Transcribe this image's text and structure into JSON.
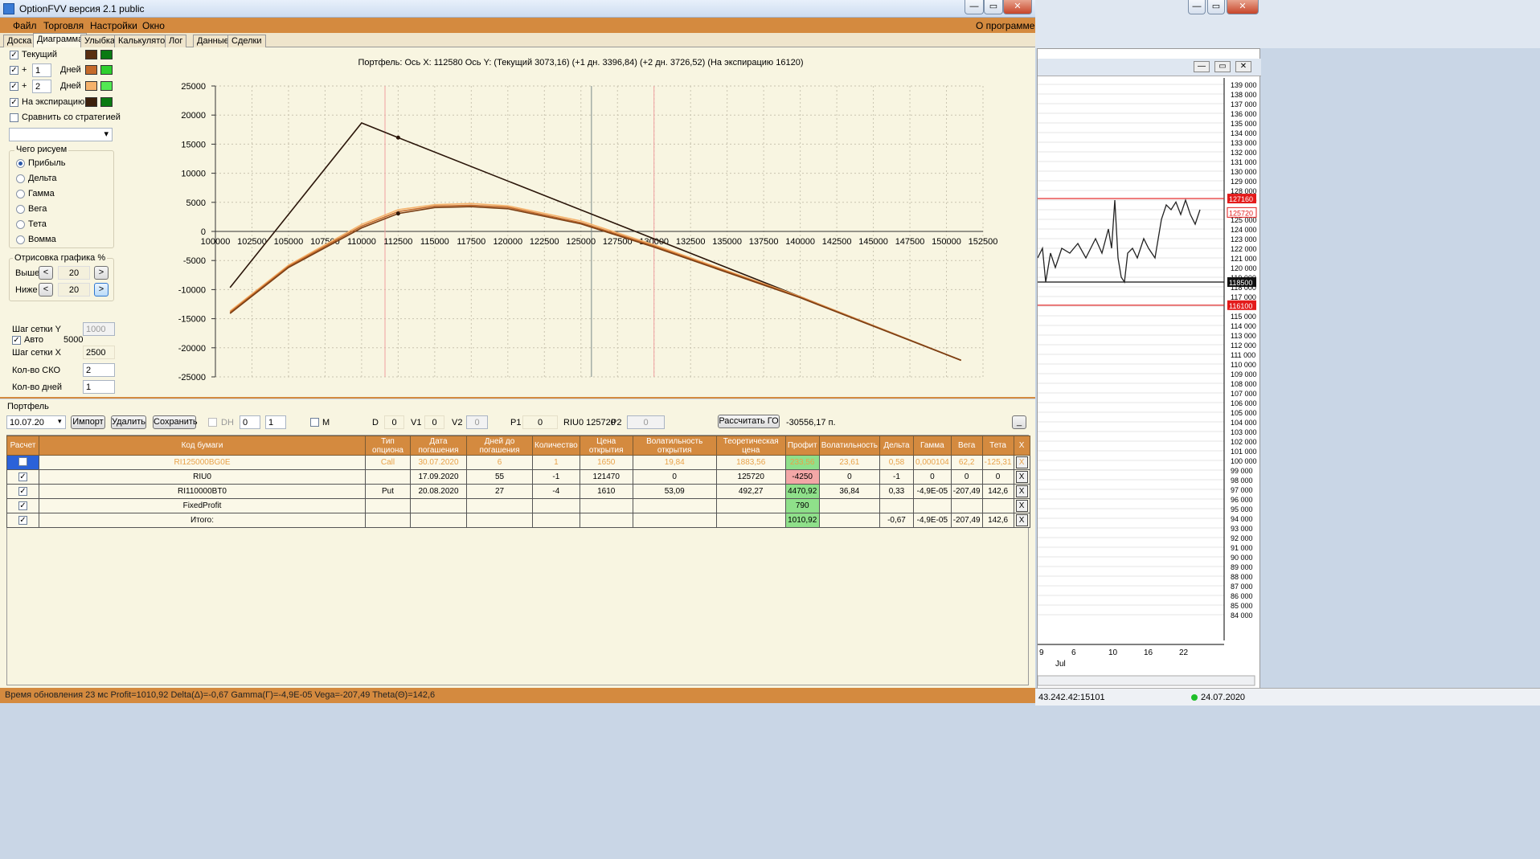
{
  "window": {
    "title": "OptionFVV версия 2.1 public",
    "min": "—",
    "max": "▭",
    "close": "✕"
  },
  "menu": {
    "items": [
      "Файл",
      "Торговля",
      "Настройки",
      "Окно"
    ],
    "about": "О программе"
  },
  "tabs": [
    "Доска",
    "Диаграмма",
    "Улыбка",
    "Калькулятор",
    "Лог",
    "Данные",
    "Сделки"
  ],
  "left": {
    "current": "Текущий",
    "plus": "+",
    "days": "Дней",
    "plus1_value": "1",
    "plus2_value": "2",
    "expiry": "На экспирацию",
    "compare": "Сравнить со стратегией",
    "what_group": "Чего рисуем",
    "radio": [
      "Прибыль",
      "Дельта",
      "Гамма",
      "Вега",
      "Тета",
      "Вомма"
    ],
    "draw_group": "Отрисовка графика %",
    "above": "Выше",
    "below": "Ниже",
    "above_val": "20",
    "below_val": "20",
    "lt": "<",
    "gt": ">",
    "grid_y": "Шаг сетки Y",
    "grid_y_val": "1000",
    "auto": "Авто",
    "auto_val": "5000",
    "grid_x": "Шаг сетки X",
    "grid_x_val": "2500",
    "sko": "Кол-во СКО",
    "sko_val": "2",
    "ndays": "Кол-во дней",
    "ndays_val": "1",
    "colors": {
      "cur_a": "#5a2f12",
      "cur_b": "#0a7a12",
      "p1_a": "#c46a2a",
      "p1_b": "#2ecf2e",
      "p2_a": "#f5b26b",
      "p2_b": "#52e952",
      "exp_a": "#3c200c",
      "exp_b": "#0a7a12"
    }
  },
  "chart_data": {
    "type": "line",
    "title": "Портфель:  Ось X:  112580  Ось Y:   (Текущий 3073,16)   (+1 дн. 3396,84)   (+2 дн. 3726,52)   (На экспирацию 16120)",
    "xlim": [
      100000,
      152500
    ],
    "ylim": [
      -25000,
      25000
    ],
    "x_ticks": [
      100000,
      102500,
      105000,
      107500,
      110000,
      112500,
      115000,
      117500,
      120000,
      122500,
      125000,
      127500,
      130000,
      132500,
      135000,
      137500,
      140000,
      142500,
      145000,
      147500,
      150000,
      152500
    ],
    "y_ticks": [
      25000,
      20000,
      15000,
      10000,
      5000,
      0,
      -5000,
      -10000,
      -15000,
      -20000,
      -25000
    ],
    "vlines": {
      "red": [
        111600,
        130000
      ],
      "gray": 125720
    },
    "series": [
      {
        "color": "#2b160a",
        "points": [
          [
            101000,
            -9650
          ],
          [
            110000,
            18650
          ],
          [
            112500,
            16120
          ],
          [
            151000,
            -22150
          ]
        ]
      },
      {
        "color": "#f5b26b",
        "points": [
          [
            101000,
            -13700
          ],
          [
            105000,
            -5800
          ],
          [
            110000,
            1200
          ],
          [
            112500,
            3730
          ],
          [
            115000,
            4600
          ],
          [
            117500,
            4800
          ],
          [
            120000,
            4400
          ],
          [
            125000,
            1800
          ],
          [
            130000,
            -2300
          ],
          [
            140000,
            -11200
          ],
          [
            151000,
            -22150
          ]
        ]
      },
      {
        "color": "#c46a2a",
        "points": [
          [
            101000,
            -13900
          ],
          [
            105000,
            -6000
          ],
          [
            110000,
            900
          ],
          [
            112500,
            3400
          ],
          [
            115000,
            4350
          ],
          [
            117500,
            4500
          ],
          [
            120000,
            4150
          ],
          [
            125000,
            1500
          ],
          [
            130000,
            -2500
          ],
          [
            140000,
            -11300
          ],
          [
            151000,
            -22150
          ]
        ]
      },
      {
        "color": "#7a3e14",
        "points": [
          [
            101000,
            -14100
          ],
          [
            105000,
            -6200
          ],
          [
            110000,
            600
          ],
          [
            112500,
            3073
          ],
          [
            115000,
            4100
          ],
          [
            117500,
            4250
          ],
          [
            120000,
            3900
          ],
          [
            125000,
            1300
          ],
          [
            130000,
            -2700
          ],
          [
            140000,
            -11400
          ],
          [
            151000,
            -22150
          ]
        ]
      }
    ],
    "markers": [
      [
        112500,
        16120
      ],
      [
        112500,
        3073
      ]
    ]
  },
  "portfolio": {
    "label": "Портфель",
    "date": "10.07.20",
    "import": "Импорт",
    "delete": "Удалить",
    "save": "Сохранить",
    "dh": "DH",
    "dh_a": "0",
    "dh_b": "1",
    "m": "M",
    "d": "D",
    "d_val": "0",
    "v1": "V1",
    "v1_val": "0",
    "v2": "V2",
    "v2_val": "0",
    "p1": "P1",
    "p1_val": "0",
    "riu": "RIU0 125720",
    "p2": "P2",
    "p2_val": "0",
    "calc_go": "Рассчитать ГО",
    "go_value": "-30556,17 п.",
    "collapse": "_"
  },
  "table": {
    "headers": [
      "Расчет",
      "Код бумаги",
      "Тип\nопциона",
      "Дата\nпогашения",
      "Дней до\nпогашения",
      "Количество",
      "Цена\nоткрытия",
      "Волатильность\nоткрытия",
      "Теоретическая\nцена",
      "Профит",
      "Волатильность",
      "Дельта",
      "Гамма",
      "Вега",
      "Тета",
      "X"
    ],
    "rows": [
      {
        "code": "RI125000BG0E",
        "type": "Call",
        "date": "30.07.2020",
        "days": "6",
        "qty": "1",
        "price": "1650",
        "vol_open": "19,84",
        "theo": "1883,56",
        "profit": "233,56",
        "vol": "23,61",
        "delta": "0,58",
        "gamma": "0,000104",
        "vega": "62,2",
        "theta": "-125,31",
        "x": "X"
      },
      {
        "code": "RIU0",
        "type": "",
        "date": "17.09.2020",
        "days": "55",
        "qty": "-1",
        "price": "121470",
        "vol_open": "0",
        "theo": "125720",
        "profit": "-4250",
        "vol": "0",
        "delta": "-1",
        "gamma": "0",
        "vega": "0",
        "theta": "0",
        "x": "X"
      },
      {
        "code": "RI110000BT0",
        "type": "Put",
        "date": "20.08.2020",
        "days": "27",
        "qty": "-4",
        "price": "1610",
        "vol_open": "53,09",
        "theo": "492,27",
        "profit": "4470,92",
        "vol": "36,84",
        "delta": "0,33",
        "gamma": "-4,9E-05",
        "vega": "-207,49",
        "theta": "142,6",
        "x": "X"
      },
      {
        "code": "FixedProfit",
        "type": "",
        "date": "",
        "days": "",
        "qty": "",
        "price": "",
        "vol_open": "",
        "theo": "",
        "profit": "790",
        "vol": "",
        "delta": "",
        "gamma": "",
        "vega": "",
        "theta": "",
        "x": "X"
      },
      {
        "code": "Итого:",
        "type": "",
        "date": "",
        "days": "",
        "qty": "",
        "price": "",
        "vol_open": "",
        "theo": "",
        "profit": "1010,92",
        "vol": "",
        "delta": "-0,67",
        "gamma": "-4,9E-05",
        "vega": "-207,49",
        "theta": "142,6",
        "x": "X"
      }
    ]
  },
  "status": {
    "text": "Время обновления 23 мс  Profit=1010,92 Delta(Δ)=-0,67 Gamma(Γ)=-4,9E-05 Vega=-207,49 Theta(Θ)=142,6"
  },
  "bgchart": {
    "prices": [
      "139 000",
      "138 000",
      "137 000",
      "136 000",
      "135 000",
      "134 000",
      "133 000",
      "132 000",
      "131 000",
      "130 000",
      "129 000",
      "128 000",
      "127 000",
      "126 000",
      "125 000",
      "124 000",
      "123 000",
      "122 000",
      "121 000",
      "120 000",
      "119 000",
      "118 000",
      "117 000",
      "116 000",
      "115 000",
      "114 000",
      "113 000",
      "112 000",
      "111 000",
      "110 000",
      "109 000",
      "108 000",
      "107 000",
      "106 000",
      "105 000",
      "104 000",
      "103 000",
      "102 000",
      "101 000",
      "100 000",
      "99 000",
      "98 000",
      "97 000",
      "96 000",
      "95 000",
      "94 000",
      "93 000",
      "92 000",
      "91 000",
      "90 000",
      "89 000",
      "88 000",
      "87 000",
      "86 000",
      "85 000",
      "84 000"
    ],
    "tag_hi": "127160",
    "tag_cur": "125720",
    "tag_mid": "118500",
    "tag_lo": "116100",
    "dates": [
      "9",
      "6",
      "10",
      "16",
      "22"
    ],
    "month": "Jul",
    "ip": "43.242.42:15101",
    "date": "24.07.2020"
  }
}
